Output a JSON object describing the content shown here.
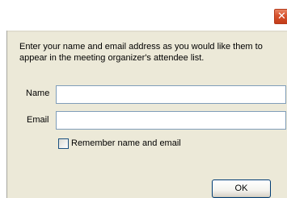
{
  "window": {
    "close_glyph": "✕"
  },
  "dialog": {
    "message": "Enter your name and email address as you would like them to appear in the meeting organizer's attendee list.",
    "name_label": "Name",
    "name_value": "",
    "email_label": "Email",
    "email_value": "",
    "remember_label": "Remember name and email",
    "remember_checked": false,
    "ok_label": "OK"
  },
  "colors": {
    "dialog_background": "#ece9d8",
    "input_border": "#7f9db9",
    "close_button": "#d7512c",
    "button_border": "#003c74"
  },
  "icons": {
    "close": "close-icon"
  }
}
